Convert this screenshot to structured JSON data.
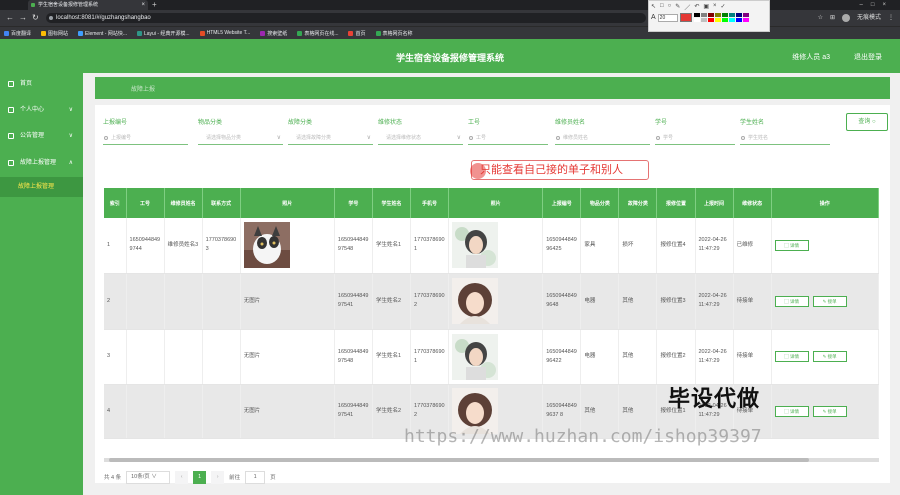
{
  "browser": {
    "tab_title": "学生宿舍设备报修管理系统",
    "url": "localhost:8081/#/guzhangshangbao",
    "profile_label": "无痕模式",
    "bookmarks": [
      "百度翻译",
      "图标网站",
      "Element - 网站快...",
      "Layui - 经典开源模...",
      "HTML5 Website T...",
      "搜索壁纸",
      "表格网页在线...",
      "首页",
      "表格网页名称"
    ],
    "annot_size": "20"
  },
  "app": {
    "title": "学生宿舍设备报修管理系统",
    "user": "维修人员 a3",
    "logout": "退出登录"
  },
  "sidebar": {
    "items": [
      {
        "label": "首页",
        "icon": "home-icon"
      },
      {
        "label": "个人中心",
        "icon": "user-icon"
      },
      {
        "label": "公告管理",
        "icon": "notice-icon"
      },
      {
        "label": "故障上报管理",
        "icon": "report-icon"
      }
    ],
    "sub_active": "故障上报管理"
  },
  "breadcrumb": "故障上报",
  "filters": [
    {
      "label": "上报编号",
      "placeholder": "上报编号",
      "type": "search"
    },
    {
      "label": "物品分类",
      "placeholder": "请选择物品分类",
      "type": "select"
    },
    {
      "label": "故障分类",
      "placeholder": "请选择故障分类",
      "type": "select"
    },
    {
      "label": "维修状态",
      "placeholder": "请选择维修状态",
      "type": "select"
    },
    {
      "label": "工号",
      "placeholder": "工号",
      "type": "search"
    },
    {
      "label": "维修员姓名",
      "placeholder": "维修员姓名",
      "type": "search"
    },
    {
      "label": "学号",
      "placeholder": "学号",
      "type": "search"
    },
    {
      "label": "学生姓名",
      "placeholder": "学生姓名",
      "type": "search"
    }
  ],
  "query_button": "查询",
  "callout": "只能查看自己接的单子和别人",
  "table": {
    "headers": [
      "索引",
      "工号",
      "维修员姓名",
      "联系方式",
      "照片",
      "学号",
      "学生姓名",
      "手机号",
      "照片",
      "上报编号",
      "物品分类",
      "故障分类",
      "报修位置",
      "上报时间",
      "维修状态",
      "操作"
    ],
    "rows": [
      {
        "idx": "1",
        "gonghao": "16509448499744",
        "name": "维修员姓名3",
        "phone": "17703786903",
        "photo1": "无图片",
        "xuehao": "165094484997548",
        "student": "学生姓名1",
        "mobile": "17703786901",
        "code": "165094484996425",
        "item": "家具",
        "fault": "损坏",
        "place": "报修位置4",
        "time": "2022-04-26 11:47:29",
        "status": "已维修",
        "actions": [
          "详情"
        ]
      },
      {
        "idx": "2",
        "gonghao": "",
        "name": "",
        "phone": "",
        "photo1": "无图片",
        "xuehao": "165094484997541",
        "student": "学生姓名2",
        "mobile": "17703786902",
        "code": "16509448499648",
        "item": "电器",
        "fault": "其他",
        "place": "报修位置3",
        "time": "2022-04-26 11:47:29",
        "status": "待接单",
        "actions": [
          "详情",
          "接单"
        ]
      },
      {
        "idx": "3",
        "gonghao": "",
        "name": "",
        "phone": "",
        "photo1": "无图片",
        "xuehao": "165094484997548",
        "student": "学生姓名1",
        "mobile": "17703786901",
        "code": "165094484996422",
        "item": "电器",
        "fault": "其他",
        "place": "报修位置2",
        "time": "2022-04-26 11:47:29",
        "status": "待接单",
        "actions": [
          "详情",
          "接单"
        ]
      },
      {
        "idx": "4",
        "gonghao": "",
        "name": "",
        "phone": "",
        "photo1": "无图片",
        "xuehao": "165094484997541",
        "student": "学生姓名2",
        "mobile": "17703786902",
        "code": "16509448499637 8",
        "item": "其他",
        "fault": "其他",
        "place": "报修位置1",
        "time": "2022-04-26 11:47:29",
        "status": "待接单",
        "actions": [
          "详情",
          "接单"
        ]
      }
    ]
  },
  "pagination": {
    "total": "共 4 条",
    "page_size": "10条/页",
    "current": "1",
    "goto_label": "前往",
    "goto_value": "1",
    "page_unit": "页"
  },
  "watermarks": {
    "main": "毕设代做",
    "url": "https://www.huzhan.com/ishop39397"
  },
  "colors": {
    "accent": "#4caf50",
    "callout": "#e53935"
  }
}
